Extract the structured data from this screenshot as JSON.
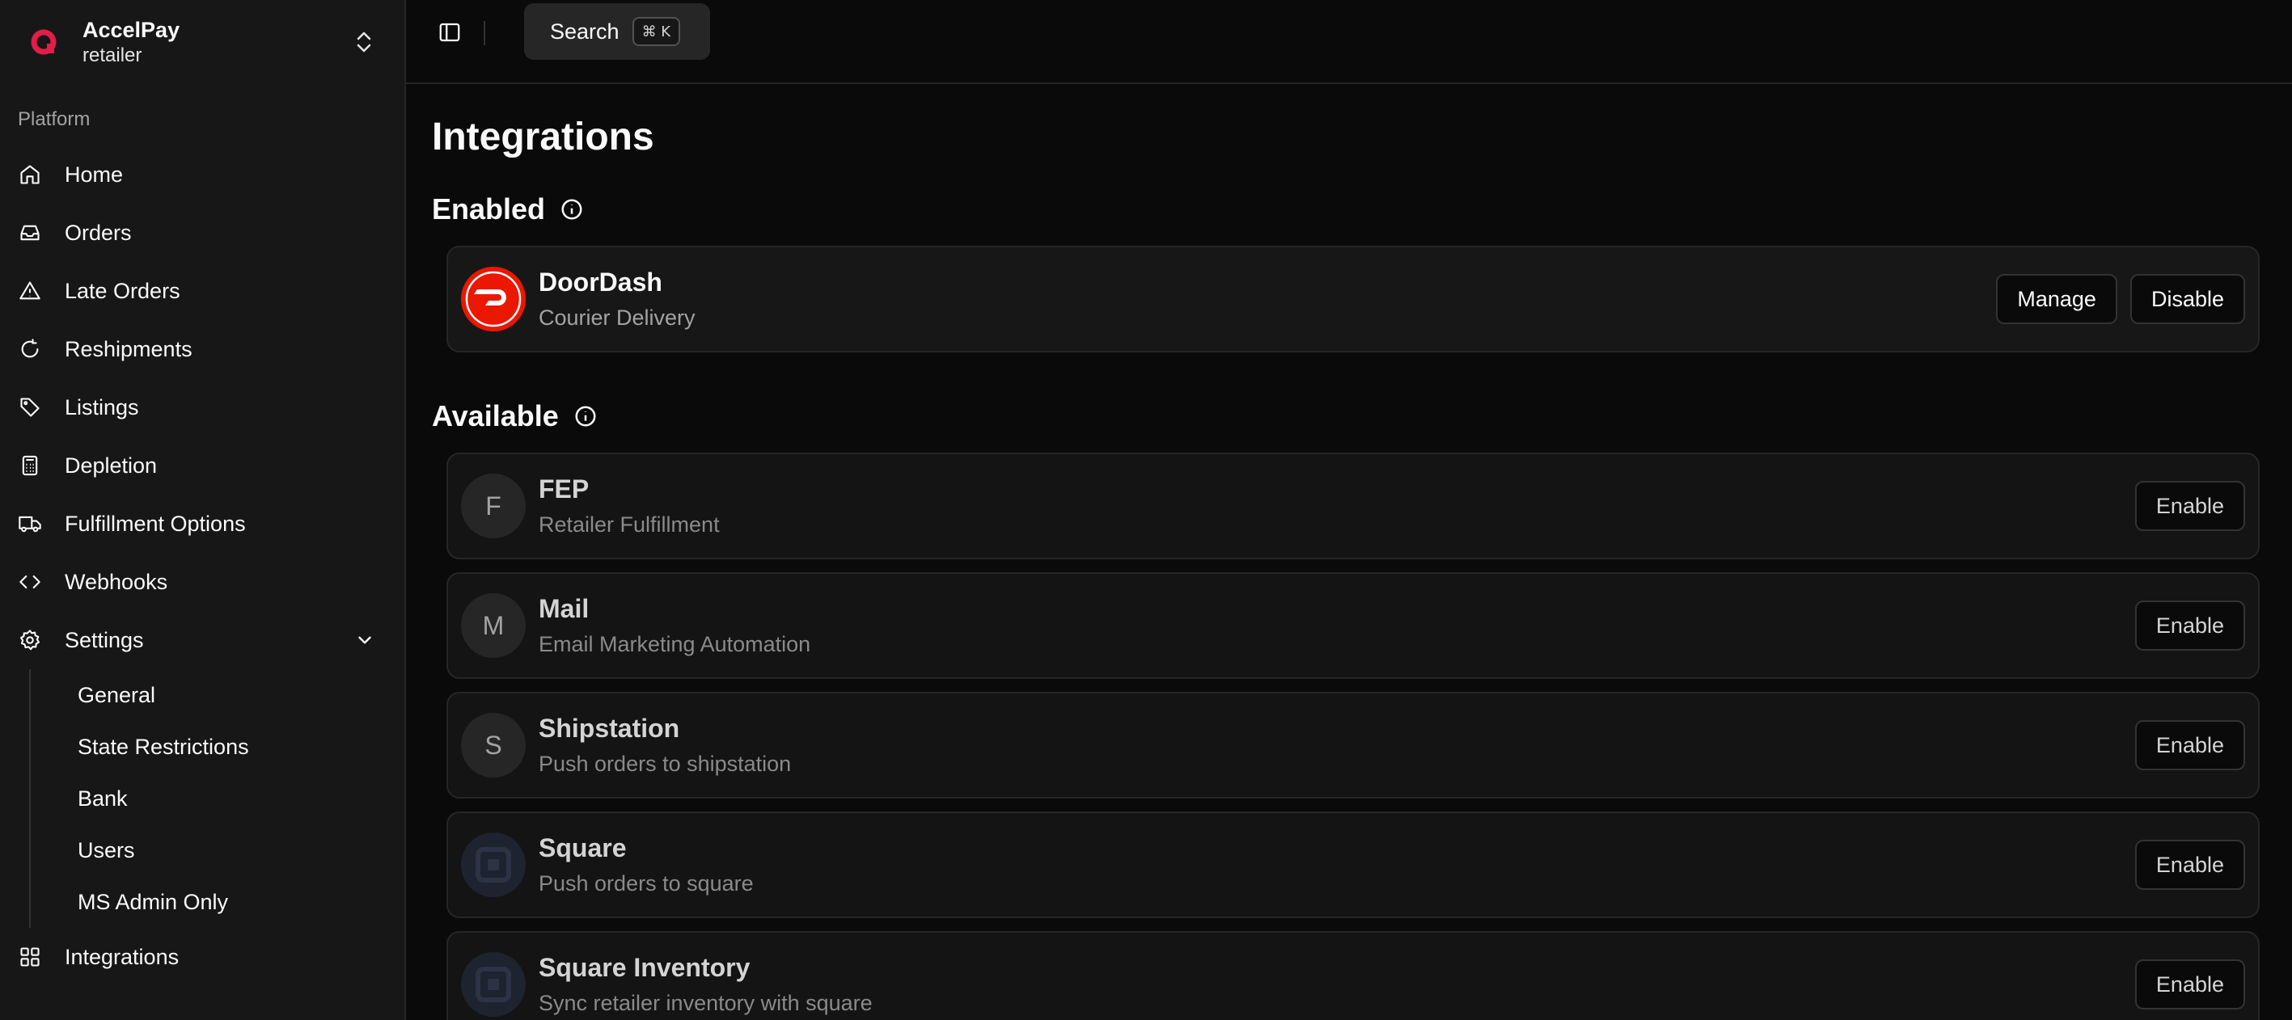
{
  "brand": {
    "name": "AccelPay",
    "sub": "retailer",
    "accent": "#e11d48"
  },
  "sidebar": {
    "group_label": "Platform",
    "items": [
      {
        "label": "Home",
        "icon": "home-icon"
      },
      {
        "label": "Orders",
        "icon": "inbox-icon"
      },
      {
        "label": "Late Orders",
        "icon": "alert-triangle-icon"
      },
      {
        "label": "Reshipments",
        "icon": "refresh-icon"
      },
      {
        "label": "Listings",
        "icon": "tag-icon"
      },
      {
        "label": "Depletion",
        "icon": "calculator-icon"
      },
      {
        "label": "Fulfillment Options",
        "icon": "truck-icon"
      },
      {
        "label": "Webhooks",
        "icon": "code-icon"
      }
    ],
    "settings": {
      "label": "Settings",
      "sub": [
        "General",
        "State Restrictions",
        "Bank",
        "Users",
        "MS Admin Only"
      ]
    },
    "integrations_label": "Integrations"
  },
  "topbar": {
    "search_label": "Search",
    "shortcut": "⌘ K"
  },
  "page": {
    "title": "Integrations",
    "enabled_heading": "Enabled",
    "available_heading": "Available"
  },
  "enabled": [
    {
      "name": "DoorDash",
      "desc": "Courier Delivery",
      "logo_text": "DOORDASH",
      "manage": "Manage",
      "disable": "Disable"
    }
  ],
  "available": [
    {
      "name": "FEP",
      "desc": "Retailer Fulfillment",
      "initial": "F",
      "action": "Enable"
    },
    {
      "name": "Mail",
      "desc": "Email Marketing Automation",
      "initial": "M",
      "action": "Enable"
    },
    {
      "name": "Shipstation",
      "desc": "Push orders to shipstation",
      "initial": "S",
      "action": "Enable"
    },
    {
      "name": "Square",
      "desc": "Push orders to square",
      "icon": "square-logo-icon",
      "action": "Enable"
    },
    {
      "name": "Square Inventory",
      "desc": "Sync retailer inventory with square",
      "icon": "square-logo-icon",
      "action": "Enable"
    }
  ]
}
